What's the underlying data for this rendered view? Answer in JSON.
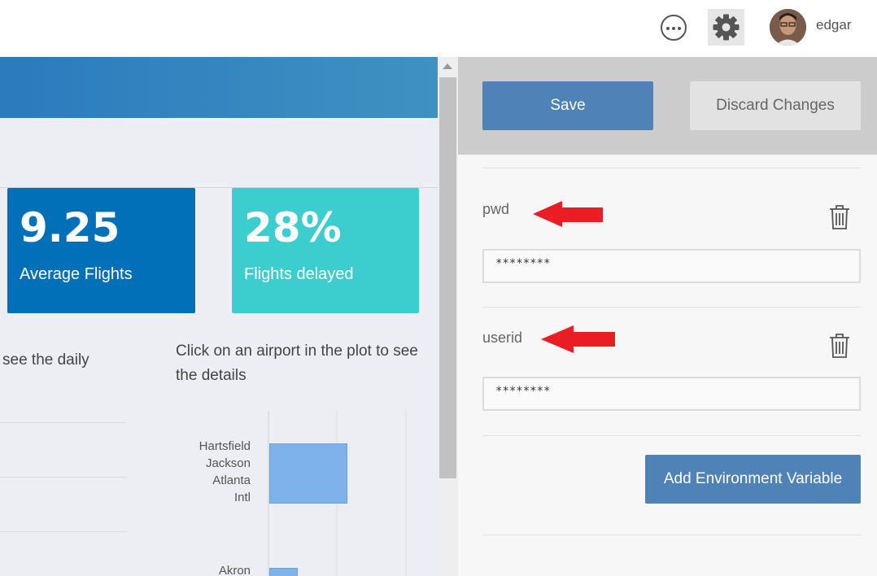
{
  "header": {
    "username": "edgar",
    "icons": [
      "more-options-icon",
      "gear-icon",
      "user-avatar"
    ]
  },
  "dashboard": {
    "kpis": [
      {
        "value": "9.25",
        "label": "Average Flights",
        "color": "#0170b8"
      },
      {
        "value": "28%",
        "label": "Flights delayed",
        "color": "#3ccece"
      }
    ],
    "left_text": "see the daily",
    "right_text": "Click on an airport in the plot to see the details",
    "chart_data": {
      "type": "bar",
      "orientation": "horizontal",
      "categories": [
        "Hartsfield Jackson Atlanta Intl",
        "Akron"
      ],
      "category_lines": [
        [
          "Hartsfield",
          "Jackson",
          "Atlanta",
          "Intl"
        ],
        [
          "Akron"
        ]
      ],
      "bar_color": "#7db3ea"
    }
  },
  "env_panel": {
    "save_label": "Save",
    "discard_label": "Discard Changes",
    "variables": [
      {
        "name": "pwd",
        "value": "********"
      },
      {
        "name": "userid",
        "value": "********"
      }
    ],
    "add_label": "Add Environment Variable",
    "accent": "#4f83b8"
  }
}
